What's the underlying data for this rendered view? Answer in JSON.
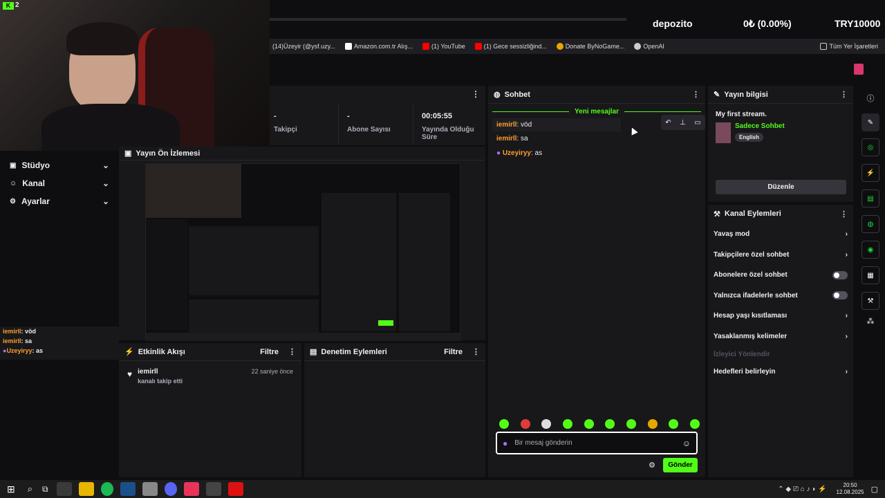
{
  "ticker": {
    "name": "depozito",
    "change": "0₺ (0.00%)",
    "amount": "TRY10000"
  },
  "bookmarks": [
    {
      "label": "(14)Üzeyir (@ysf.uzy..."
    },
    {
      "label": "Amazon.com.tr Alış..."
    },
    {
      "label": "(1) YouTube"
    },
    {
      "label": "(1) Gece sessizliğind..."
    },
    {
      "label": "Donate ByNoGame..."
    },
    {
      "label": "OpenAI"
    }
  ],
  "bookmarks_all": "Tüm Yer İşaretleri",
  "kick_badge": "2",
  "sidebar": {
    "items": [
      {
        "label": "Stüdyo"
      },
      {
        "label": "Kanal"
      },
      {
        "label": "Ayarlar"
      }
    ]
  },
  "left_chat": [
    {
      "user": "iemirll",
      "msg": ": vöd"
    },
    {
      "user": "iemirll",
      "msg": ": sa"
    },
    {
      "user": "Uzeyiryy",
      "msg": ": as"
    }
  ],
  "stats": [
    {
      "value": "-",
      "label": "Takipçi"
    },
    {
      "value": "-",
      "label": "Abone Sayısı"
    },
    {
      "value": "00:05:55",
      "label": "Yayında Olduğu Süre"
    }
  ],
  "preview_title": "Yayın Ön İzlemesi",
  "activity": {
    "title": "Etkinlik Akışı",
    "filter": "Filtre",
    "user": "iemirll",
    "action": "kanalı takip etti",
    "time": "22 saniye önce"
  },
  "moderation": {
    "title": "Denetim Eylemleri",
    "filter": "Filtre"
  },
  "chat": {
    "title": "Sohbet",
    "new_messages": "Yeni mesajlar",
    "messages": [
      {
        "user": "iemirll",
        "msg": ": vöd"
      },
      {
        "user": "iemirll",
        "msg": ": sa"
      },
      {
        "user": "Uzeyiryy",
        "msg": ": as"
      }
    ],
    "placeholder": "Bir mesaj gönderin",
    "send": "Gönder"
  },
  "stream_info": {
    "title": "Yayın bilgisi",
    "stream_name": "My first stream.",
    "category": "Sadece Sohbet",
    "language": "English",
    "edit": "Düzenle"
  },
  "channel_actions": {
    "title": "Kanal Eylemleri",
    "items": [
      {
        "label": "Yavaş mod",
        "type": "arrow"
      },
      {
        "label": "Takipçilere özel sohbet",
        "type": "arrow"
      },
      {
        "label": "Abonelere özel sohbet",
        "type": "toggle"
      },
      {
        "label": "Yalnızca ifadelerle sohbet",
        "type": "toggle"
      },
      {
        "label": "Hesap yaşı kısıtlaması",
        "type": "arrow"
      },
      {
        "label": "Yasaklanmış kelimeler",
        "type": "arrow"
      },
      {
        "label": "İzleyici Yönlendir",
        "type": "disabled"
      },
      {
        "label": "Hedefleri belirleyin",
        "type": "arrow"
      }
    ]
  },
  "clock": {
    "time": "20:50",
    "date": "12.08.2025"
  },
  "colors": {
    "accent": "#53fc18",
    "bg": "#0e0e10",
    "panel": "#18181b"
  }
}
